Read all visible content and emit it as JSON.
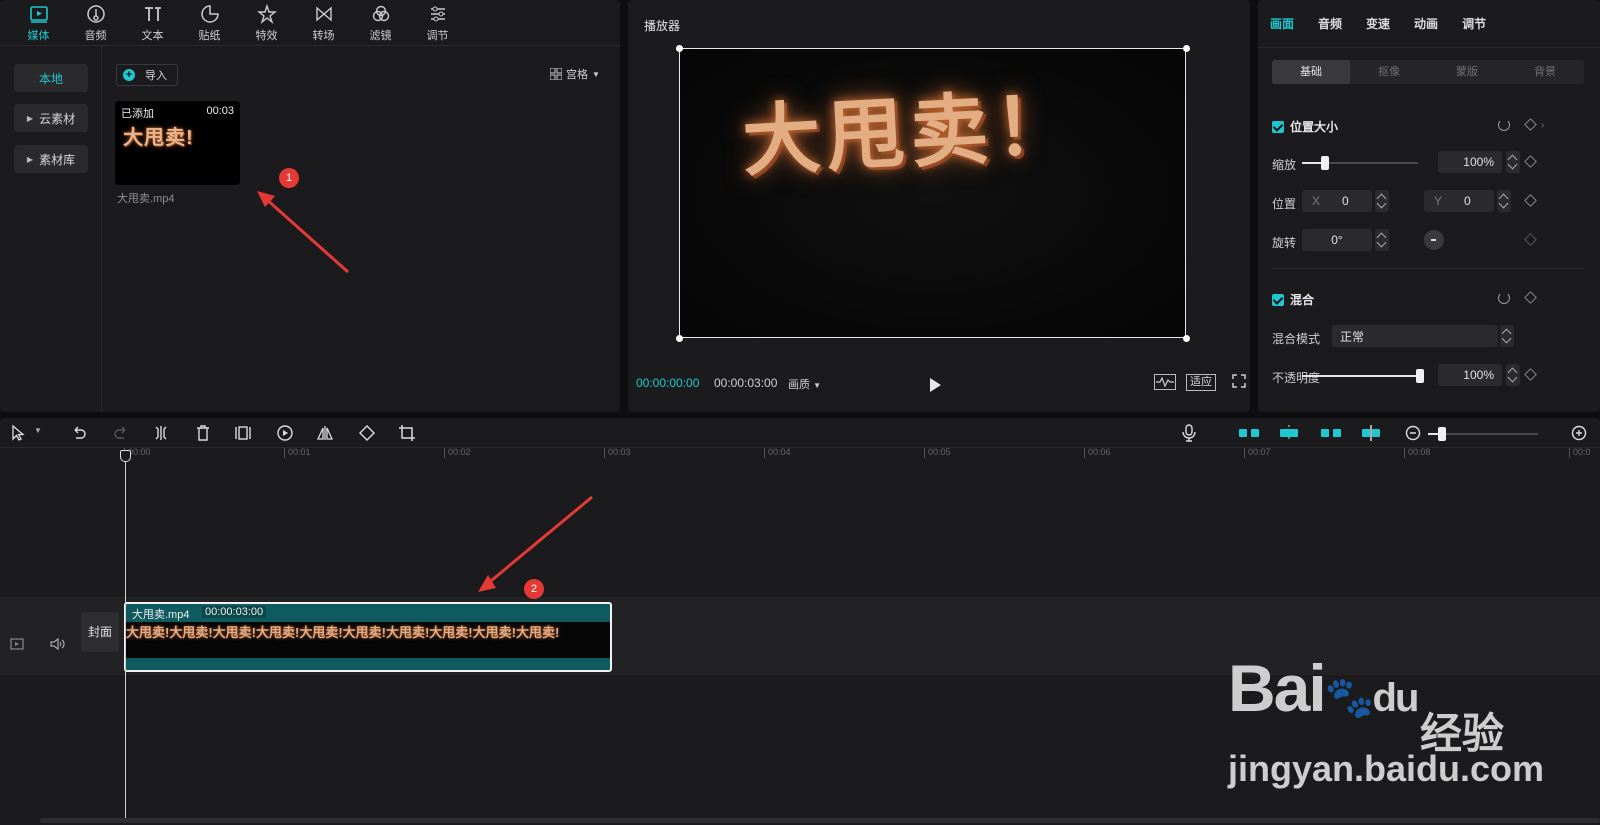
{
  "media_toolbar": {
    "tabs": [
      {
        "label": "媒体",
        "icon": "media-icon"
      },
      {
        "label": "音频",
        "icon": "audio-icon"
      },
      {
        "label": "文本",
        "icon": "text-icon"
      },
      {
        "label": "贴纸",
        "icon": "sticker-icon"
      },
      {
        "label": "特效",
        "icon": "effects-icon"
      },
      {
        "label": "转场",
        "icon": "transition-icon"
      },
      {
        "label": "滤镜",
        "icon": "filter-icon"
      },
      {
        "label": "调节",
        "icon": "adjust-icon"
      }
    ],
    "active_tab": "媒体"
  },
  "media_sidebar": {
    "items": [
      {
        "label": "本地"
      },
      {
        "label": "云素材"
      },
      {
        "label": "素材库"
      }
    ]
  },
  "media": {
    "import_label": "导入",
    "view_label": "宫格",
    "item": {
      "status": "已添加",
      "duration": "00:03",
      "thumb_text": "大甩卖!",
      "filename": "大甩卖.mp4"
    }
  },
  "player": {
    "title": "播放器",
    "canvas_text": "大甩卖！",
    "current_time": "00:00:00:00",
    "total_time": "00:00:03:00",
    "quality_label": "画质",
    "fit_label": "适应"
  },
  "properties": {
    "tabs": [
      "画面",
      "音频",
      "变速",
      "动画",
      "调节"
    ],
    "active_tab": "画面",
    "subtabs": [
      "基础",
      "抠像",
      "蒙版",
      "背景"
    ],
    "active_subtab": "基础",
    "position_size": {
      "title": "位置大小",
      "scale_label": "缩放",
      "scale_value": "100%",
      "scale_fraction": 0.2,
      "position_label": "位置",
      "x_label": "X",
      "x_value": "0",
      "y_label": "Y",
      "y_value": "0",
      "rotation_label": "旋转",
      "rotation_value": "0°"
    },
    "blend": {
      "title": "混合",
      "mode_label": "混合模式",
      "mode_value": "正常",
      "opacity_label": "不透明度",
      "opacity_value": "100%",
      "opacity_fraction": 1.0
    }
  },
  "timeline": {
    "ruler_ticks": [
      "00:00",
      "00:01",
      "00:02",
      "00:03",
      "00:04",
      "00:05",
      "00:06",
      "00:07",
      "00:08",
      "00:0"
    ],
    "cover_label": "封面",
    "clip": {
      "name": "大甩卖.mp4",
      "duration": "00:00:03:00",
      "frames_text": "大甩卖!大甩卖!大甩卖!大甩卖!大甩卖!大甩卖!大甩卖!大甩卖!大甩卖!大甩卖!"
    }
  },
  "annotations": [
    "1",
    "2"
  ],
  "watermark": {
    "brand": "Bai",
    "brand2": "du",
    "suffix": "经验",
    "url": "jingyan.baidu.com"
  },
  "colors": {
    "accent": "#1fc8d0",
    "clip": "#0f5a5e",
    "marker": "#e53935"
  }
}
